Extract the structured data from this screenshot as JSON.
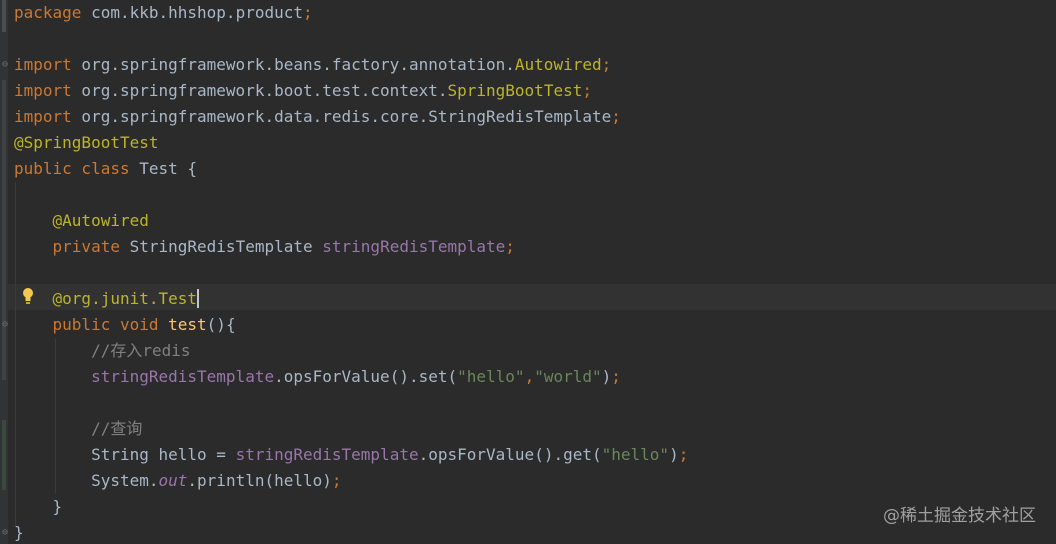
{
  "editor": {
    "lines": [
      [
        {
          "t": "package",
          "c": "kw"
        },
        {
          "t": " com.kkb.hhshop.product",
          "c": "plain"
        },
        {
          "t": ";",
          "c": "kw"
        }
      ],
      [],
      [
        {
          "t": "import",
          "c": "kw"
        },
        {
          "t": " org.springframework.beans.factory.annotation.",
          "c": "plain"
        },
        {
          "t": "Autowired",
          "c": "ann"
        },
        {
          "t": ";",
          "c": "kw"
        }
      ],
      [
        {
          "t": "import",
          "c": "kw"
        },
        {
          "t": " org.springframework.boot.test.context.",
          "c": "plain"
        },
        {
          "t": "SpringBootTest",
          "c": "ann"
        },
        {
          "t": ";",
          "c": "kw"
        }
      ],
      [
        {
          "t": "import",
          "c": "kw"
        },
        {
          "t": " org.springframework.data.redis.core.StringRedisTemplate",
          "c": "plain"
        },
        {
          "t": ";",
          "c": "kw"
        }
      ],
      [
        {
          "t": "@SpringBootTest",
          "c": "ann"
        }
      ],
      [
        {
          "t": "public class",
          "c": "kw"
        },
        {
          "t": " Test {",
          "c": "plain"
        }
      ],
      [],
      [
        {
          "t": "    ",
          "c": "plain"
        },
        {
          "t": "@Autowired",
          "c": "ann"
        }
      ],
      [
        {
          "t": "    ",
          "c": "plain"
        },
        {
          "t": "private",
          "c": "kw"
        },
        {
          "t": " StringRedisTemplate ",
          "c": "plain"
        },
        {
          "t": "stringRedisTemplate",
          "c": "field"
        },
        {
          "t": ";",
          "c": "kw"
        }
      ],
      [],
      [
        {
          "t": "    ",
          "c": "plain"
        },
        {
          "t": "@org.junit.",
          "c": "ann"
        },
        {
          "t": "Test",
          "c": "ann"
        },
        {
          "t": "",
          "c": "caret"
        }
      ],
      [
        {
          "t": "    ",
          "c": "plain"
        },
        {
          "t": "public void",
          "c": "kw"
        },
        {
          "t": " ",
          "c": "plain"
        },
        {
          "t": "test",
          "c": "fn"
        },
        {
          "t": "(){",
          "c": "plain"
        }
      ],
      [
        {
          "t": "        ",
          "c": "plain"
        },
        {
          "t": "//存入redis",
          "c": "com"
        }
      ],
      [
        {
          "t": "        ",
          "c": "plain"
        },
        {
          "t": "stringRedisTemplate",
          "c": "field"
        },
        {
          "t": ".opsForValue().set(",
          "c": "plain"
        },
        {
          "t": "\"hello\"",
          "c": "str"
        },
        {
          "t": ",",
          "c": "kw"
        },
        {
          "t": "\"world\"",
          "c": "str"
        },
        {
          "t": ")",
          "c": "plain"
        },
        {
          "t": ";",
          "c": "kw"
        }
      ],
      [],
      [
        {
          "t": "        ",
          "c": "plain"
        },
        {
          "t": "//查询",
          "c": "com"
        }
      ],
      [
        {
          "t": "        ",
          "c": "plain"
        },
        {
          "t": "String hello = ",
          "c": "plain"
        },
        {
          "t": "stringRedisTemplate",
          "c": "field"
        },
        {
          "t": ".opsForValue().get(",
          "c": "plain"
        },
        {
          "t": "\"hello\"",
          "c": "str"
        },
        {
          "t": ")",
          "c": "plain"
        },
        {
          "t": ";",
          "c": "kw"
        }
      ],
      [
        {
          "t": "        ",
          "c": "plain"
        },
        {
          "t": "System.",
          "c": "plain"
        },
        {
          "t": "out",
          "c": "field-it"
        },
        {
          "t": ".println(hello)",
          "c": "plain"
        },
        {
          "t": ";",
          "c": "kw"
        }
      ],
      [
        {
          "t": "    }",
          "c": "plain"
        }
      ],
      [
        {
          "t": "}",
          "c": "plain"
        }
      ]
    ]
  },
  "watermark": "@稀土掘金技术社区",
  "icons": {
    "intention": "lightbulb-icon",
    "fold": "fold-marker-icon"
  },
  "colors": {
    "background": "#2b2b2b",
    "keyword": "#cc7832",
    "annotation": "#bbb529",
    "field": "#9876aa",
    "method": "#ffc66d",
    "string": "#6a8759",
    "comment": "#808080",
    "text": "#a9b7c6"
  }
}
